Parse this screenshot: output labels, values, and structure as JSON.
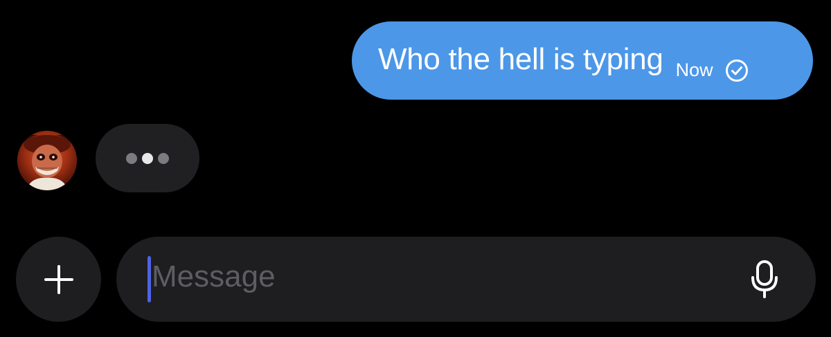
{
  "outgoing_message": {
    "text": "Who the hell is typing",
    "time": "Now",
    "status_icon": "check-circle-icon",
    "bubble_color": "#4c97e8"
  },
  "typing_indicator": {
    "avatar": "avatar",
    "dot_count": 3
  },
  "composer": {
    "add_icon": "plus-icon",
    "placeholder": "Message",
    "mic_icon": "microphone-icon",
    "caret_color": "#4f63e6"
  }
}
